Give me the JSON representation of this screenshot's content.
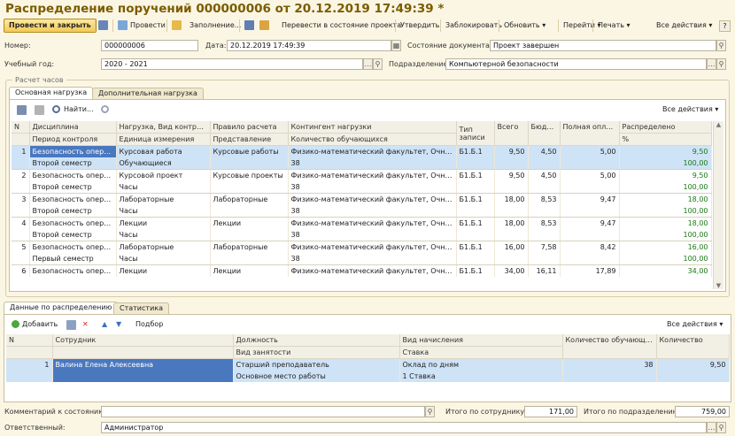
{
  "title": "Распределение поручений 000000006 от 20.12.2019 17:49:39 *",
  "toolbar": {
    "post_close": "Провести и закрыть",
    "post": "Провести",
    "fill": "Заполнение...",
    "change_state": "Перевести в состояние проекта",
    "approve": "Утвердить",
    "lock": "Заблокировать",
    "refresh": "Обновить",
    "goto": "Перейти",
    "print": "Печать",
    "all_actions": "Все действия"
  },
  "header": {
    "number_label": "Номер:",
    "number": "000000006",
    "date_label": "Дата:",
    "date": "20.12.2019 17:49:39",
    "state_label": "Состояние документа:",
    "state": "Проект завершен",
    "year_label": "Учебный год:",
    "year": "2020 - 2021",
    "dept_label": "Подразделение:",
    "dept": "Компьютерной безопасности"
  },
  "hours": {
    "group_title": "Расчет часов",
    "tabs": [
      "Основная нагрузка",
      "Дополнительная нагрузка"
    ],
    "find": "Найти...",
    "all_actions": "Все действия",
    "cols_top": [
      "N",
      "Дисциплина",
      "Нагрузка, Вид контрол...",
      "Правило расчета",
      "Контингент нагрузки",
      "Тип записи",
      "Всего",
      "Бюджет",
      "Полная оплата",
      "Распределено"
    ],
    "cols_bot": [
      "",
      "Период контроля",
      "Единица измерения",
      "Представление",
      "Количество обучающихся",
      "",
      "",
      "",
      "",
      "%"
    ],
    "rows": [
      {
        "n": "1",
        "disc": "Безопасность опера...",
        "load": "Курсовая работа",
        "rule": "Курсовые работы",
        "contingent": "Физико-математический факультет, Очная, ...",
        "type": "Б1.Б.1",
        "total": "9,50",
        "budget": "4,50",
        "full": "5,00",
        "dist": "9,50",
        "period": "Второй семестр",
        "unit": "Обучающиеся",
        "repr": "",
        "qty": "38",
        "pct": "100,00"
      },
      {
        "n": "2",
        "disc": "Безопасность опера...",
        "load": "Курсовой проект",
        "rule": "Курсовые проекты",
        "contingent": "Физико-математический факультет, Очная, ...",
        "type": "Б1.Б.1",
        "total": "9,50",
        "budget": "4,50",
        "full": "5,00",
        "dist": "9,50",
        "period": "Второй семестр",
        "unit": "Часы",
        "repr": "",
        "qty": "38",
        "pct": "100,00"
      },
      {
        "n": "3",
        "disc": "Безопасность опера...",
        "load": "Лабораторные",
        "rule": "Лабораторные",
        "contingent": "Физико-математический факультет, Очная, ...",
        "type": "Б1.Б.1",
        "total": "18,00",
        "budget": "8,53",
        "full": "9,47",
        "dist": "18,00",
        "period": "Второй семестр",
        "unit": "Часы",
        "repr": "",
        "qty": "38",
        "pct": "100,00"
      },
      {
        "n": "4",
        "disc": "Безопасность опера...",
        "load": "Лекции",
        "rule": "Лекции",
        "contingent": "Физико-математический факультет, Очная, ...",
        "type": "Б1.Б.1",
        "total": "18,00",
        "budget": "8,53",
        "full": "9,47",
        "dist": "18,00",
        "period": "Второй семестр",
        "unit": "Часы",
        "repr": "",
        "qty": "38",
        "pct": "100,00"
      },
      {
        "n": "5",
        "disc": "Безопасность опера...",
        "load": "Лабораторные",
        "rule": "Лабораторные",
        "contingent": "Физико-математический факультет, Очная, ...",
        "type": "Б1.Б.1",
        "total": "16,00",
        "budget": "7,58",
        "full": "8,42",
        "dist": "16,00",
        "period": "Первый семестр",
        "unit": "Часы",
        "repr": "",
        "qty": "38",
        "pct": "100,00"
      },
      {
        "n": "6",
        "disc": "Безопасность опера...",
        "load": "Лекции",
        "rule": "Лекции",
        "contingent": "Физико-математический факультет, Очная, ...",
        "type": "Б1.Б.1",
        "total": "34,00",
        "budget": "16,11",
        "full": "17,89",
        "dist": "34,00",
        "period": "",
        "unit": "",
        "repr": "",
        "qty": "",
        "pct": ""
      }
    ]
  },
  "dist": {
    "tabs": [
      "Данные по распределению",
      "Статистика"
    ],
    "add": "Добавить",
    "selection": "Подбор",
    "all_actions": "Все действия",
    "cols_top": [
      "N",
      "Сотрудник",
      "Должность",
      "Вид начисления",
      "Количество обучающихся",
      "Количество"
    ],
    "cols_bot": [
      "",
      "",
      "Вид занятости",
      "Ставка",
      "",
      ""
    ],
    "rows": [
      {
        "n": "1",
        "employee": "Валина Елена Алексеевна",
        "position": "Старший преподаватель",
        "accrual": "Оклад по дням",
        "students": "38",
        "qty": "9,50",
        "employment": "Основное место работы",
        "rate": "1 Ставка"
      }
    ]
  },
  "footer": {
    "comment_label": "Комментарий к состоянию:",
    "comment": "",
    "by_employee_label": "Итого по сотруднику:",
    "by_employee": "171,00",
    "by_dept_label": "Итого по подразделению:",
    "by_dept": "759,00",
    "responsible_label": "Ответственный:",
    "responsible": "Администратор"
  }
}
